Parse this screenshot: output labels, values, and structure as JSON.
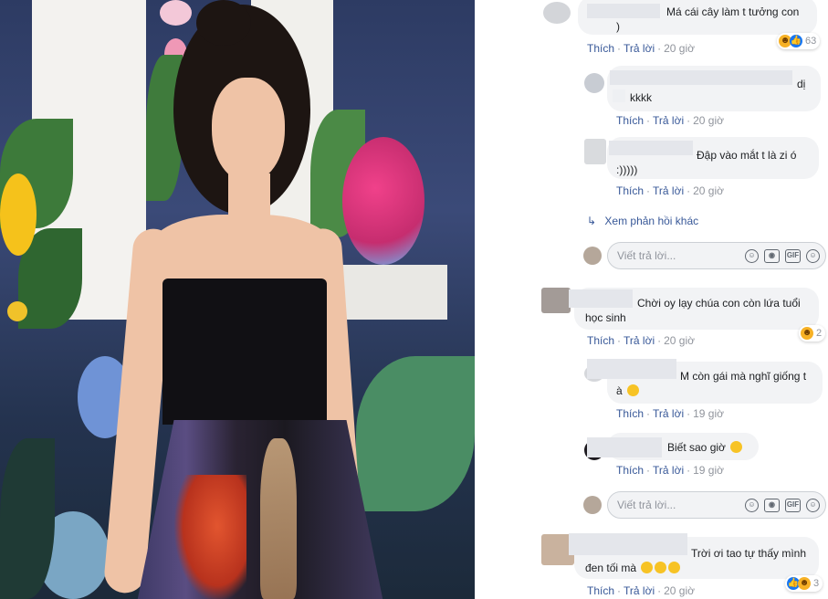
{
  "comments": [
    {
      "text_line1": "Má cái cây làm t tưởng con",
      "text_line2": ")",
      "actions": {
        "like": "Thích",
        "reply": "Trả lời",
        "time": "20 giờ"
      },
      "reaction_count": "63"
    },
    {
      "text_line1": "dị",
      "text_line2": "kkkk",
      "actions": {
        "like": "Thích",
        "reply": "Trả lời",
        "time": "20 giờ"
      }
    },
    {
      "text_line1": "Đập vào mắt t là zi ó",
      "text_line2": ":)))))",
      "actions": {
        "like": "Thích",
        "reply": "Trả lời",
        "time": "20 giờ"
      }
    },
    {
      "text_line1": "Chời oy lạy chúa con còn lứa tuổi",
      "text_line2": "học sinh",
      "actions": {
        "like": "Thích",
        "reply": "Trả lời",
        "time": "20 giờ"
      },
      "reaction_count": "2"
    },
    {
      "text_line1": "M còn gái mà nghĩ giống t",
      "text_line2": "à",
      "actions": {
        "like": "Thích",
        "reply": "Trả lời",
        "time": "19 giờ"
      }
    },
    {
      "text_line1": "Biết sao giờ",
      "actions": {
        "like": "Thích",
        "reply": "Trả lời",
        "time": "19 giờ"
      }
    },
    {
      "text_line1": "Trời ơi tao tự thấy mình",
      "text_line2": "đen tối mà",
      "actions": {
        "like": "Thích",
        "reply": "Trả lời",
        "time": "20 giờ"
      },
      "reaction_count": "3"
    }
  ],
  "more_replies_link": "Xem phản hồi khác",
  "reply_placeholder": "Viết trả lời...",
  "reply_icons": [
    "emoji-icon",
    "camera-icon",
    "gif-icon",
    "sticker-icon"
  ],
  "gif_label": "GIF",
  "colors": {
    "link_blue": "#385898",
    "bubble_gray": "#f2f3f5",
    "meta_gray": "#90949c",
    "like_blue": "#1877f2",
    "haha_yellow": "#f7b125"
  }
}
